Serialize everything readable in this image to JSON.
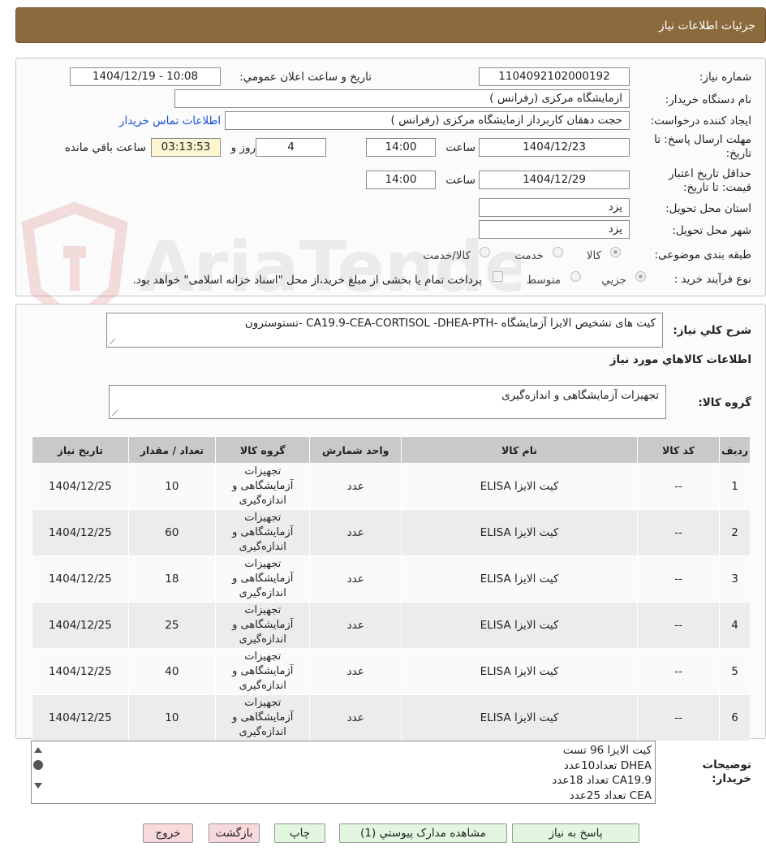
{
  "header": {
    "title": "جزئیات اطلاعات نیاز"
  },
  "form": {
    "need_number_label": "شماره نیاز:",
    "need_number": "1104092102000192",
    "announce_label": "تاریخ و ساعت اعلان عمومي:",
    "announce_value": "1404/12/19 - 10:08",
    "buyer_org_label": "نام دستگاه خريدار:",
    "buyer_org": "ازمایشگاه مرکزی (رفرانس )",
    "creator_label": "ايجاد کننده درخواست:",
    "creator": "حجت دهقان کاربرداز ازمایشگاه مرکزی (رفرانس )",
    "contact_link": "اطلاعات تماس خريدار",
    "deadline_label": "مهلت ارسال پاسخ: تا تاريخ:",
    "deadline_date": "1404/12/23",
    "time_label": "ساعت",
    "deadline_time": "14:00",
    "days_value": "4",
    "days_label": "روز و",
    "remaining_time": "03:13:53",
    "remaining_label": "ساعت باقي مانده",
    "validity_label": "حداقل تاريخ اعتبار قيمت: تا تاريخ:",
    "validity_date": "1404/12/29",
    "validity_time": "14:00",
    "province_label": "استان محل تحويل:",
    "province": "یزد",
    "city_label": "شهر محل تحويل:",
    "city": "یزد",
    "category_label": "طبقه بندی موضوعی:",
    "category_options": [
      "کالا",
      "خدمت",
      "کالا/خدمت"
    ],
    "process_label": "نوع فرآيند خريد :",
    "process_options": [
      "جزيي",
      "متوسط"
    ],
    "payment_note": "پرداخت تمام يا بخشی از مبلغ خريد،از محل \"اسناد خزانه اسلامی\" خواهد بود."
  },
  "description": {
    "label": "شرح کلي نياز:",
    "text": "کیت های تشخیص الایزا آزمایشگاه -CA19.9-CEA-CORTISOL -DHEA-PTH -تستوسترون",
    "goods_info_title": "اطلاعات کالاهاي مورد نياز",
    "goods_group_label": "گروه کالا:",
    "goods_group_value": "تجهیزات آزمایشگاهی و اندازه‌گیری"
  },
  "table": {
    "headers": [
      "رديف",
      "کد کالا",
      "نام کالا",
      "واحد شمارش",
      "گروه کالا",
      "تعداد / مقدار",
      "تاريخ نياز"
    ],
    "rows": [
      {
        "row": "1",
        "code": "--",
        "name": "کیت الایزا ELISA",
        "unit": "عدد",
        "group": "تجهیزات آزمایشگاهی و اندازه‌گیری",
        "qty": "10",
        "date": "1404/12/25"
      },
      {
        "row": "2",
        "code": "--",
        "name": "کیت الایزا ELISA",
        "unit": "عدد",
        "group": "تجهیزات آزمایشگاهی و اندازه‌گیری",
        "qty": "60",
        "date": "1404/12/25"
      },
      {
        "row": "3",
        "code": "--",
        "name": "کیت الایزا ELISA",
        "unit": "عدد",
        "group": "تجهیزات آزمایشگاهی و اندازه‌گیری",
        "qty": "18",
        "date": "1404/12/25"
      },
      {
        "row": "4",
        "code": "--",
        "name": "کیت الایزا ELISA",
        "unit": "عدد",
        "group": "تجهیزات آزمایشگاهی و اندازه‌گیری",
        "qty": "25",
        "date": "1404/12/25"
      },
      {
        "row": "5",
        "code": "--",
        "name": "کیت الایزا ELISA",
        "unit": "عدد",
        "group": "تجهیزات آزمایشگاهی و اندازه‌گیری",
        "qty": "40",
        "date": "1404/12/25"
      },
      {
        "row": "6",
        "code": "--",
        "name": "کیت الایزا ELISA",
        "unit": "عدد",
        "group": "تجهیزات آزمایشگاهی و اندازه‌گیری",
        "qty": "10",
        "date": "1404/12/25"
      }
    ]
  },
  "notes": {
    "label": "توضيحات خريدار:",
    "lines": [
      "کیت الایزا 96 تست",
      "DHEA تعداد10عدد",
      "CA19.9 تعداد 18عدد",
      "CEA تعداد 25عدد"
    ]
  },
  "buttons": {
    "reply": "پاسخ به نياز",
    "attachments": "مشاهده مدارک پيوستي (1)",
    "print": "چاپ",
    "back": "بازگشت",
    "exit": "خروج"
  },
  "watermark": {
    "text": "AriaTender.neT"
  }
}
